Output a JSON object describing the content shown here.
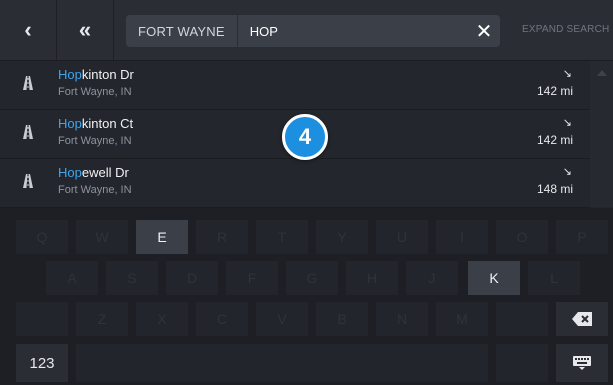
{
  "nav": {
    "back_icon": "chevron-left-icon",
    "back_glyph": "‹",
    "first_icon": "double-chevron-left-icon",
    "first_glyph": "«"
  },
  "search": {
    "city": "FORT WAYNE",
    "query": "HOP",
    "clear_glyph": "✕",
    "expand_label": "EXPAND SEARCH"
  },
  "results": [
    {
      "match": "Hop",
      "rest": "kinton Dr",
      "address": "Fort Wayne, IN",
      "direction_glyph": "↘",
      "distance": "142 mi"
    },
    {
      "match": "Hop",
      "rest": "kinton Ct",
      "address": "Fort Wayne, IN",
      "direction_glyph": "↘",
      "distance": "142 mi"
    },
    {
      "match": "Hop",
      "rest": "ewell Dr",
      "address": "Fort Wayne, IN",
      "direction_glyph": "↘",
      "distance": "148 mi"
    }
  ],
  "badge": {
    "number": "4"
  },
  "keyboard": {
    "row1": [
      "Q",
      "W",
      "E",
      "R",
      "T",
      "Y",
      "U",
      "I",
      "O",
      "P"
    ],
    "row2": [
      "A",
      "S",
      "D",
      "F",
      "G",
      "H",
      "J",
      "K",
      "L"
    ],
    "row3": [
      "Z",
      "X",
      "C",
      "V",
      "B",
      "N",
      "M"
    ],
    "active_keys": [
      "E",
      "K"
    ],
    "numbers_label": "123",
    "backspace_icon": "backspace-icon",
    "hide_keyboard_icon": "keyboard-hide-icon"
  },
  "colors": {
    "accent": "#3aa7f0",
    "badge": "#1d8fe0",
    "background": "#22252b"
  }
}
